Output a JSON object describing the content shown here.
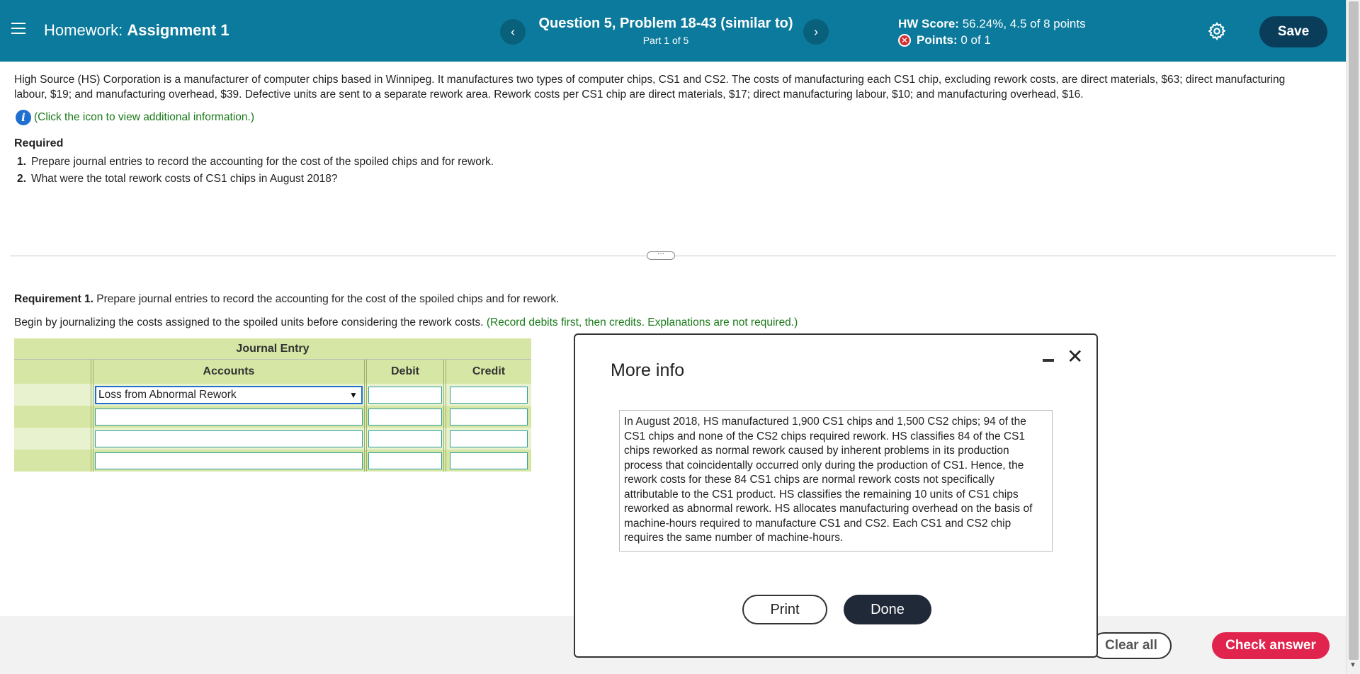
{
  "header": {
    "hw_prefix": "Homework:",
    "hw_name": "Assignment 1",
    "prev_label": "‹",
    "next_label": "›",
    "question_title": "Question 5, Problem 18-43 (similar to)",
    "part": "Part 1 of 5",
    "score_label": "HW Score:",
    "score_value": "56.24%, 4.5 of 8 points",
    "points_label": "Points:",
    "points_value": "0 of 1",
    "save_label": "Save"
  },
  "problem": {
    "text": "High Source (HS) Corporation is a manufacturer of computer chips based in Winnipeg. It manufactures two types of computer chips, CS1 and CS2. The costs of manufacturing each CS1 chip, excluding rework costs, are direct materials, $63; direct manufacturing labour, $19; and manufacturing overhead, $39. Defective units are sent to a separate rework area. Rework costs per CS1 chip are direct materials, $17; direct manufacturing labour, $10; and manufacturing overhead, $16.",
    "info_link": "(Click the icon to view additional information.)",
    "required_heading": "Required",
    "requirements": [
      {
        "num": "1.",
        "text": "Prepare journal entries to record the accounting for the cost of the spoiled chips and for rework."
      },
      {
        "num": "2.",
        "text": "What were the total rework costs of CS1 chips in August 2018?"
      }
    ]
  },
  "requirement1": {
    "label": "Requirement 1.",
    "text": " Prepare journal entries to record the accounting for the cost of the spoiled chips and for rework.",
    "instruction": "Begin by journalizing the costs assigned to the spoiled units before considering the rework costs. ",
    "hint": "(Record debits first, then credits. Explanations are not required.)"
  },
  "journal": {
    "title": "Journal Entry",
    "columns": [
      "Accounts",
      "Debit",
      "Credit"
    ],
    "rows": [
      {
        "account": "Loss from Abnormal Rework",
        "debit": "",
        "credit": ""
      },
      {
        "account": "",
        "debit": "",
        "credit": ""
      },
      {
        "account": "",
        "debit": "",
        "credit": ""
      },
      {
        "account": "",
        "debit": "",
        "credit": ""
      }
    ]
  },
  "modal": {
    "title": "More info",
    "body": "In August 2018, HS manufactured 1,900 CS1 chips and 1,500 CS2 chips; 94 of the CS1 chips and none of the CS2 chips required rework. HS classifies 84 of the CS1 chips reworked as normal rework caused by inherent problems in its production process that coincidentally occurred only during the production of CS1. Hence, the rework costs for these 84 CS1 chips are normal rework costs not specifically attributable to the CS1 product. HS classifies the remaining 10 units of CS1 chips reworked as abnormal rework. HS allocates manufacturing overhead on the basis of machine-hours required to manufacture CS1 and CS2. Each CS1 and CS2 chip requires the same number of machine-hours.",
    "print_label": "Print",
    "done_label": "Done",
    "close_glyph": "✕"
  },
  "footer": {
    "clear_label": "Clear all",
    "check_label": "Check answer"
  },
  "colors": {
    "header_bg": "#0b7a9c",
    "save_bg": "#0a3d5a",
    "table_bg": "#d6e6a4",
    "check_bg": "#e0244d",
    "hint_green": "#1a7a1a"
  },
  "icons": [
    "hamburger-icon",
    "chevron-left-icon",
    "chevron-right-icon",
    "error-x-icon",
    "gear-icon",
    "info-icon",
    "dropdown-arrow-icon",
    "minimize-icon",
    "close-icon"
  ]
}
